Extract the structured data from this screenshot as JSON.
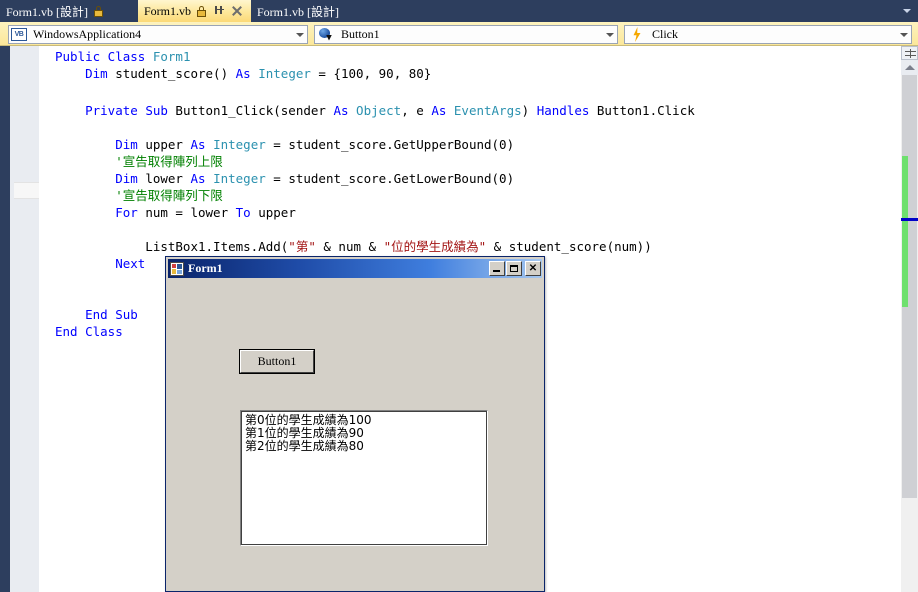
{
  "tabs": [
    {
      "label": "Form1.vb [設計]",
      "state": "inactive",
      "pinned": true,
      "icons": [
        "pin-icon"
      ]
    },
    {
      "label": "Form1.vb",
      "state": "active",
      "pinned": true,
      "icons": [
        "pin-icon",
        "dock-icon",
        "close-icon"
      ]
    },
    {
      "label": "Form1.vb [設計]",
      "state": "inactive",
      "pinned": false,
      "icons": []
    }
  ],
  "tab_overflow_icon": "chevron-down-icon",
  "navbar": {
    "project_combo": {
      "icon": "vb-project-icon",
      "value": "WindowsApplication4",
      "caret": "chevron-down-icon"
    },
    "object_combo": {
      "icon": "object-icon",
      "value": "Button1",
      "caret": "chevron-down-icon"
    },
    "member_combo": {
      "icon": "lightning-bolt-icon",
      "value": "Click",
      "caret": "chevron-down-icon"
    }
  },
  "editor": {
    "lines": [
      {
        "indent": 0,
        "tokens": [
          [
            "kw",
            "Public Class "
          ],
          [
            "ty",
            "Form1"
          ]
        ]
      },
      {
        "indent": 1,
        "tokens": [
          [
            "kw",
            "Dim "
          ],
          [
            "pl",
            "student_score() "
          ],
          [
            "kw",
            "As "
          ],
          [
            "ty",
            "Integer"
          ],
          [
            "pl",
            " = {100, 90, 80}"
          ]
        ]
      },
      {
        "indent": 0,
        "tokens": []
      },
      {
        "indent": 1,
        "tokens": [
          [
            "kw",
            "Private Sub "
          ],
          [
            "pl",
            "Button1_Click(sender "
          ],
          [
            "kw",
            "As "
          ],
          [
            "ty",
            "Object"
          ],
          [
            "pl",
            ", e "
          ],
          [
            "kw",
            "As "
          ],
          [
            "ty",
            "EventArgs"
          ],
          [
            "pl",
            ") "
          ],
          [
            "kw",
            "Handles "
          ],
          [
            "pl",
            "Button1.Click"
          ]
        ]
      },
      {
        "indent": 0,
        "tokens": []
      },
      {
        "indent": 2,
        "tokens": [
          [
            "kw",
            "Dim "
          ],
          [
            "pl",
            "upper "
          ],
          [
            "kw",
            "As "
          ],
          [
            "ty",
            "Integer"
          ],
          [
            "pl",
            " = student_score.GetUpperBound(0)"
          ]
        ]
      },
      {
        "indent": 2,
        "tokens": [
          [
            "cm",
            "'宣告取得陣列上限"
          ]
        ]
      },
      {
        "indent": 2,
        "tokens": [
          [
            "kw",
            "Dim "
          ],
          [
            "pl",
            "lower "
          ],
          [
            "kw",
            "As "
          ],
          [
            "ty",
            "Integer"
          ],
          [
            "pl",
            " = student_score.GetLowerBound(0)"
          ]
        ]
      },
      {
        "indent": 2,
        "tokens": [
          [
            "cm",
            "'宣告取得陣列下限"
          ]
        ],
        "current": true
      },
      {
        "indent": 2,
        "tokens": [
          [
            "kw",
            "For "
          ],
          [
            "pl",
            "num = lower "
          ],
          [
            "kw",
            "To "
          ],
          [
            "pl",
            "upper"
          ]
        ]
      },
      {
        "indent": 0,
        "tokens": []
      },
      {
        "indent": 3,
        "tokens": [
          [
            "pl",
            "ListBox1.Items.Add("
          ],
          [
            "st",
            "\"第\""
          ],
          [
            "pl",
            " & num & "
          ],
          [
            "st",
            "\"位的學生成績為\""
          ],
          [
            "pl",
            " & student_score(num))"
          ]
        ]
      },
      {
        "indent": 2,
        "tokens": [
          [
            "kw",
            "Next"
          ]
        ]
      },
      {
        "indent": 0,
        "tokens": []
      },
      {
        "indent": 0,
        "tokens": []
      },
      {
        "indent": 1,
        "tokens": [
          [
            "kw",
            "End Sub"
          ]
        ]
      },
      {
        "indent": 0,
        "tokens": [
          [
            "kw",
            "End Class"
          ]
        ]
      }
    ],
    "colors": {
      "keyword": "#0000ff",
      "type": "#2b91af",
      "comment": "#008000",
      "string": "#a31515",
      "plain": "#000000",
      "change_bar": "#6ee06e",
      "current_line_bg": "#f7f7f7"
    },
    "outline_toggles": [
      "collapse-box-public-class",
      "collapse-box-private-sub"
    ]
  },
  "vscrollbar": {
    "up_arrow_icon": "scroll-up-arrow-icon",
    "split_icon": "split-window-icon",
    "thumb_label": "vertical-scroll-thumb",
    "marker_color": "#0000c8",
    "change_color": "#6ee06e"
  },
  "form_window": {
    "title": "Form1",
    "icon": "vb-form-icon",
    "buttons": {
      "minimize": "minimize-button",
      "maximize": "maximize-button",
      "close": "✕"
    },
    "button1_label": "Button1",
    "listbox_items": [
      "第0位的學生成績為100",
      "第1位的學生成績為90",
      "第2位的學生成績為80"
    ]
  }
}
